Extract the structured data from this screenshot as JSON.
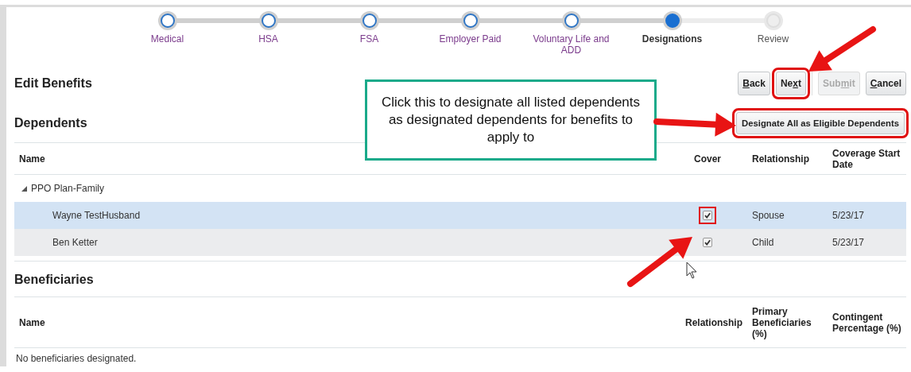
{
  "train": [
    {
      "label": "Medical",
      "visited": true,
      "current": false
    },
    {
      "label": "HSA",
      "visited": true,
      "current": false
    },
    {
      "label": "FSA",
      "visited": true,
      "current": false
    },
    {
      "label": "Employer Paid",
      "visited": true,
      "current": false
    },
    {
      "label": "Voluntary Life and ADD",
      "visited": true,
      "current": false
    },
    {
      "label": "Designations",
      "visited": false,
      "current": true
    },
    {
      "label": "Review",
      "visited": false,
      "current": false
    }
  ],
  "page_title": "Edit Benefits",
  "buttons": [
    {
      "access_key": "B",
      "after": "ack",
      "disabled": false,
      "highlighted": false
    },
    {
      "before": "Ne",
      "access_key": "x",
      "after": "t",
      "disabled": false,
      "highlighted": true
    },
    {
      "before": "Sub",
      "access_key": "m",
      "after": "it",
      "disabled": true,
      "highlighted": false
    },
    {
      "access_key": "C",
      "after": "ancel",
      "disabled": false,
      "highlighted": false
    }
  ],
  "dependents": {
    "title": "Dependents",
    "action_button": {
      "label": "Designate All as Eligible Dependents",
      "highlighted": true
    },
    "columns": [
      "Name",
      "Cover",
      "Relationship",
      "Coverage Start Date"
    ],
    "groups": [
      {
        "label": "PPO Plan-Family",
        "expanded": true,
        "rows": [
          {
            "name": "Wayne TestHusband",
            "cover": true,
            "cover_highlighted": true,
            "relationship": "Spouse",
            "start_date": "5/23/17",
            "selected": true
          },
          {
            "name": "Ben Ketter",
            "cover": true,
            "cover_highlighted": false,
            "relationship": "Child",
            "start_date": "5/23/17",
            "selected": false
          }
        ]
      }
    ]
  },
  "beneficiaries": {
    "title": "Beneficiaries",
    "columns": [
      "Name",
      "Relationship",
      "Primary Beneficiaries (%)",
      "Contingent Percentage (%)"
    ],
    "empty_text": "No beneficiaries designated."
  },
  "callout": "Click this to designate all listed dependents as designated dependents for benefits to apply to"
}
